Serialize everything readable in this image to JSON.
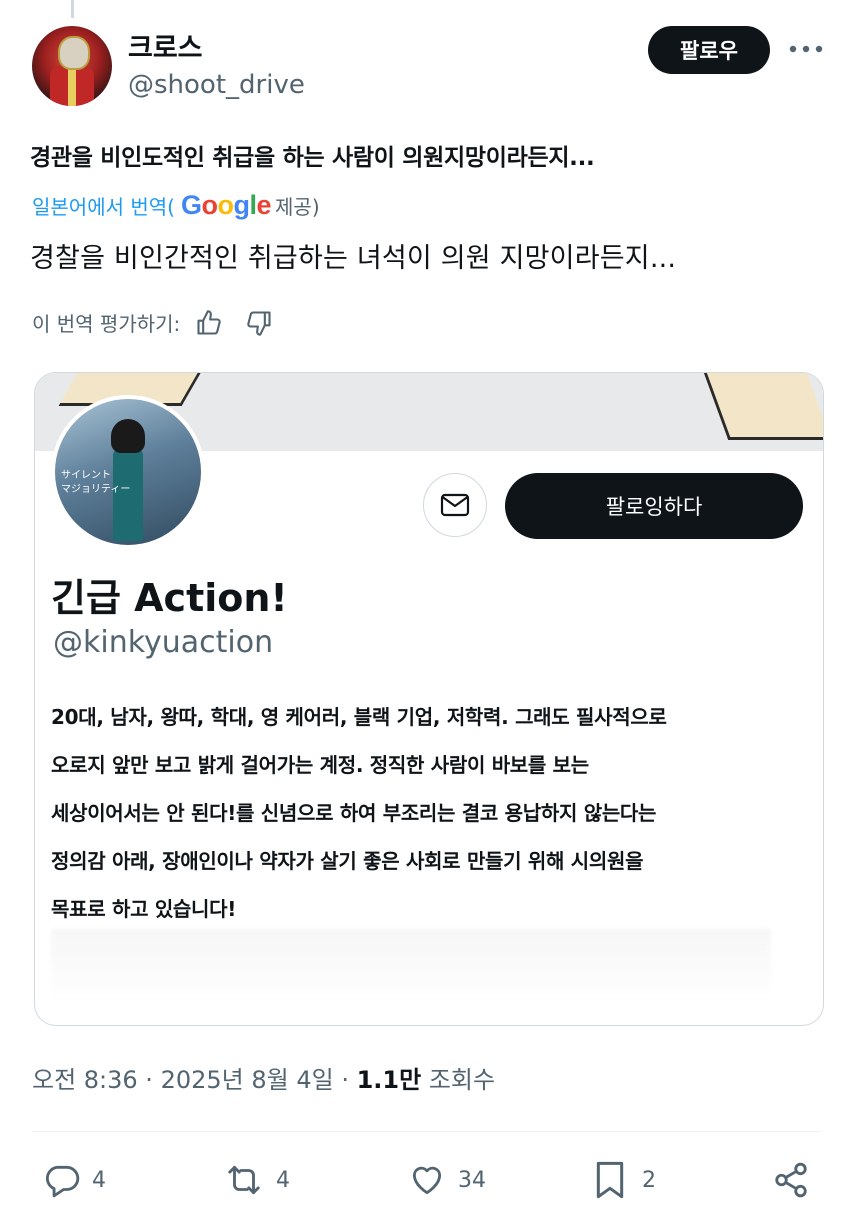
{
  "author": {
    "display_name": "크로스",
    "handle": "@shoot_drive"
  },
  "header": {
    "follow_label": "팔로우",
    "more_icon": "more-dots-icon"
  },
  "post": {
    "original_text": "경관을 비인도적인 취급을 하는 사람이 의원지망이라든지...",
    "translate_from": "일본어에서 번역(",
    "translate_provider": "Google",
    "translate_suffix": " 제공)",
    "translated_text": "경찰을 비인간적인 취급하는 녀석이 의원 지망이라든지...",
    "rate_label": "이 번역 평가하기:"
  },
  "card": {
    "following_label": "팔로잉하다",
    "name": "긴급 Action!",
    "handle": "@kinkyuaction",
    "profile_pic_text": "サイレント\nマジョリティー",
    "bio_lines": [
      "20대, 남자, 왕따, 학대, 영 케어러, 블랙 기업, 저학력. 그래도 필사적으로",
      "오로지 앞만 보고 밝게 걸어가는 계정. 정직한 사람이 바보를 보는",
      "세상이어서는 안 된다!를 신념으로 하여 부조리는 결코 용납하지 않는다는",
      "정의감 아래, 장애인이나 약자가 살기 좋은 사회로 만들기 위해 시의원을",
      "목표로 하고 있습니다!"
    ]
  },
  "meta": {
    "time": "오전 8:36 · 2025년 8월 4일 · ",
    "views": "1.1만",
    "views_label": " 조회수"
  },
  "actions": {
    "replies": "4",
    "reposts": "4",
    "likes": "34",
    "bookmarks": "2"
  },
  "colors": {
    "accent": "#1d9bf0",
    "text": "#0f1419",
    "muted": "#536471",
    "border": "#cfd9de"
  }
}
